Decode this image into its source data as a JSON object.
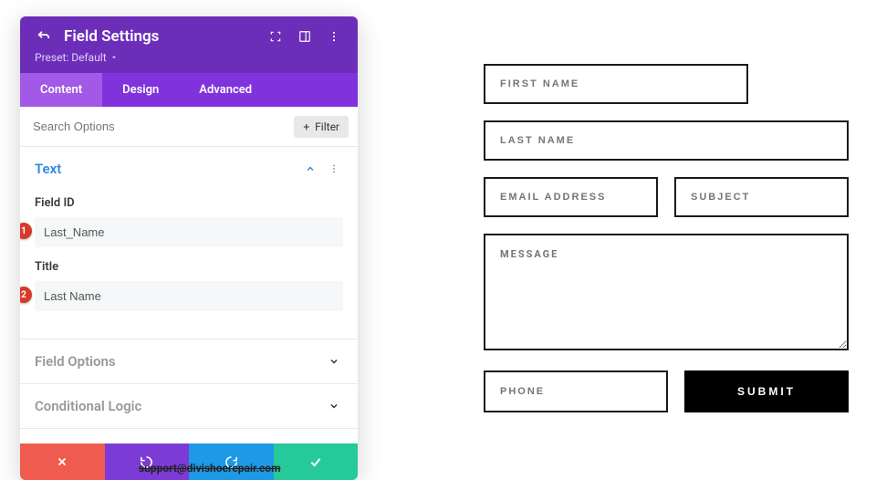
{
  "header": {
    "title": "Field Settings",
    "preset_label": "Preset: Default"
  },
  "tabs": {
    "content": "Content",
    "design": "Design",
    "advanced": "Advanced"
  },
  "search": {
    "placeholder": "Search Options",
    "filter_label": "Filter"
  },
  "sections": {
    "text": {
      "title": "Text",
      "field_id_label": "Field ID",
      "field_id_value": "Last_Name",
      "title_label": "Title",
      "title_value": "Last Name"
    },
    "field_options": {
      "title": "Field Options"
    },
    "conditional_logic": {
      "title": "Conditional Logic"
    }
  },
  "badges": {
    "one": "1",
    "two": "2"
  },
  "support_text": "support@divishoerepair.com",
  "preview": {
    "first_name": "FIRST NAME",
    "last_name": "LAST NAME",
    "email": "EMAIL ADDRESS",
    "subject": "SUBJECT",
    "message": "MESSAGE",
    "phone": "PHONE",
    "submit": "SUBMIT"
  }
}
